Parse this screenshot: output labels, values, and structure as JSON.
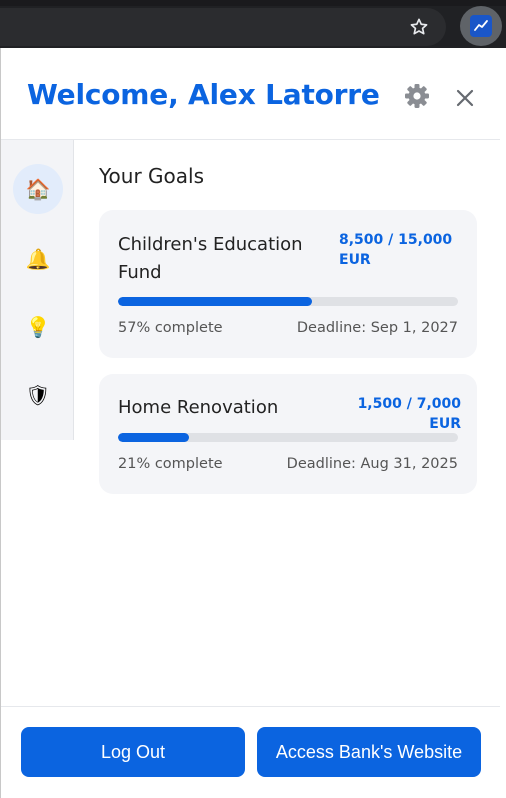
{
  "browser": {
    "star_icon": "bookmark-star-icon",
    "extension_icon": "trend-chart-icon"
  },
  "header": {
    "welcome": "Welcome, Alex Latorre",
    "settings_icon": "gear-icon",
    "close_icon": "close-icon"
  },
  "sidebar": {
    "items": [
      {
        "icon": "home-icon",
        "glyph": "🏠",
        "active": true
      },
      {
        "icon": "bell-icon",
        "glyph": "🔔",
        "active": false
      },
      {
        "icon": "lightbulb-icon",
        "glyph": "💡",
        "active": false
      },
      {
        "icon": "shield-icon",
        "glyph": "🛡",
        "active": false
      }
    ]
  },
  "main": {
    "title": "Your Goals",
    "goals": [
      {
        "name": "Children's Education Fund",
        "amount": "8,500 / 15,000 EUR",
        "progress": 0.57,
        "percent_text": "57% complete",
        "deadline": "Deadline: Sep 1, 2027"
      },
      {
        "name": "Home Renovation",
        "amount": "1,500 / 7,000 EUR",
        "progress": 0.21,
        "percent_text": "21% complete",
        "deadline": "Deadline: Aug 31, 2025"
      }
    ]
  },
  "footer": {
    "logout": "Log Out",
    "bank_site": "Access Bank's Website"
  },
  "colors": {
    "accent": "#0b64e0",
    "card_bg": "#f4f5f8",
    "sidebar_bg": "#f3f4f7"
  }
}
